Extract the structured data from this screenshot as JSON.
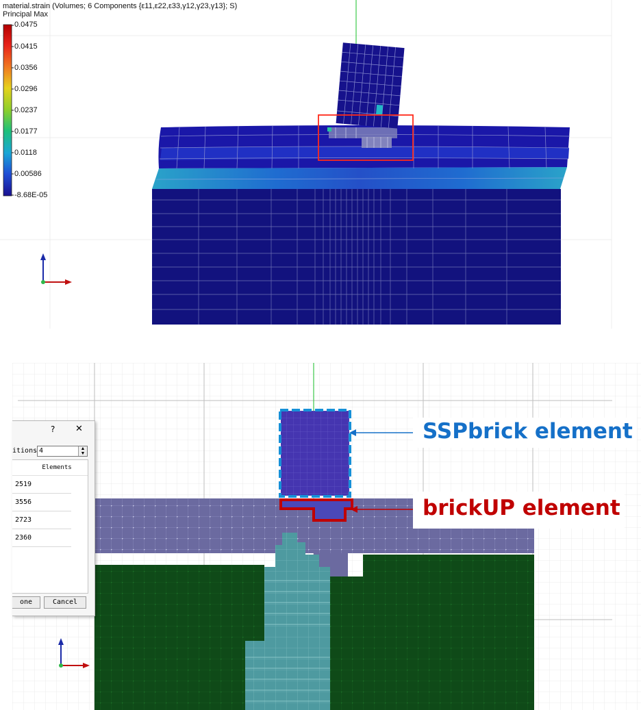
{
  "top_view": {
    "title": "material.strain (Volumes; 6 Components {ε11,ε22,ε33,γ12,γ23,γ13}; S)",
    "subtitle": "Principal Max",
    "colorbar": {
      "labels": [
        "0.0475",
        "0.0415",
        "0.0356",
        "0.0296",
        "0.0237",
        "0.0177",
        "0.0118",
        "0.00586",
        "-8.68E-05"
      ],
      "colors": [
        "#b30000",
        "#e8221a",
        "#f07a20",
        "#e6d21c",
        "#8ccf2c",
        "#1fc07a",
        "#1aa6d6",
        "#1f4fd6",
        "#1a1090"
      ]
    },
    "highlight_color": "#ff2a1a"
  },
  "bottom_view": {
    "dialog": {
      "help_label": "?",
      "close_label": "✕",
      "field_label": "itions",
      "field_value": "4",
      "column_header": "Elements",
      "rows": [
        "2519",
        "3556",
        "2723",
        "2360"
      ],
      "done_label": "one",
      "cancel_label": "Cancel"
    },
    "callouts": {
      "ssp": {
        "label": "SSPbrick element",
        "color": "#1570c8"
      },
      "brickup": {
        "label": "brickUP element",
        "color": "#c00000"
      }
    },
    "colors": {
      "ssp_block": "#4535b0",
      "layer": "#6b6aa0",
      "foundation": "#0f4a18",
      "core": "#4e9aa0"
    }
  },
  "axis_icons": [
    "axis-triad-icon",
    "axis-triad-icon"
  ]
}
